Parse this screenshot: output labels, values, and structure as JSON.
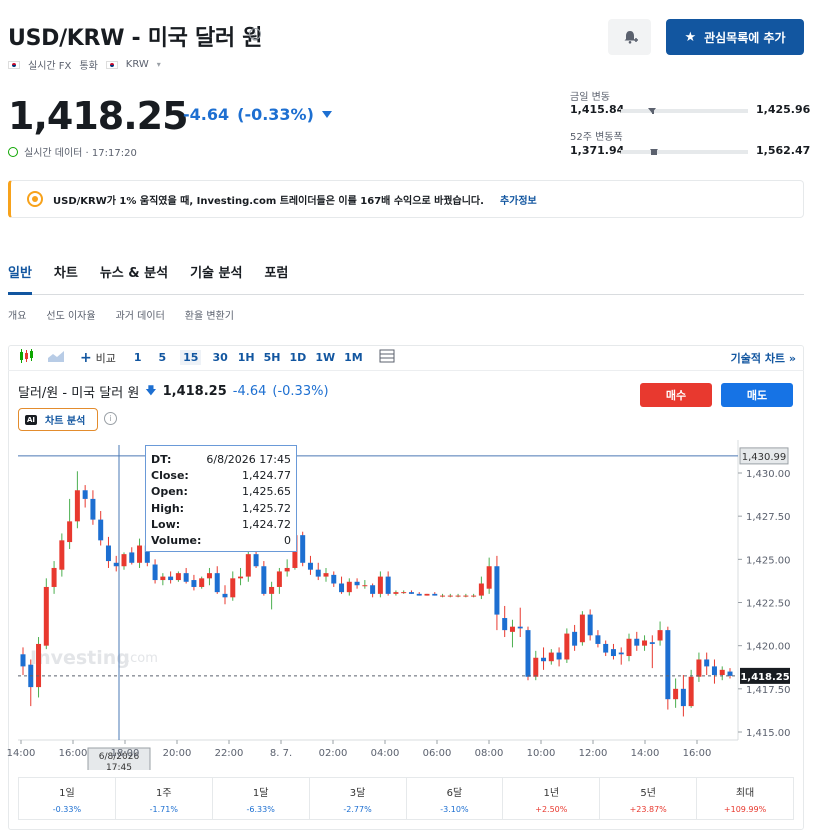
{
  "header": {
    "title": "USD/KRW - 미국 달러 원",
    "realtime_fx": "실시간 FX",
    "currency_label": "통화",
    "currency": "KRW",
    "watchlist_button": "관심목록에 추가"
  },
  "quote": {
    "price": "1,418.25",
    "change": "-4.64",
    "change_pct": "(-0.33%)",
    "realtime_label": "실시간 데이터 · 17:17:20"
  },
  "ranges": {
    "day_label": "금일 변동",
    "day_low": "1,415.84",
    "day_high": "1,425.96",
    "week52_label": "52주 변동폭",
    "week52_low": "1,371.94",
    "week52_high": "1,562.47"
  },
  "banner": {
    "text": "USD/KRW가 1% 움직였을 때, Investing.com 트레이더들은 이를 167배 수익으로 바꿨습니다.",
    "link": "추가정보"
  },
  "tabs": [
    "일반",
    "차트",
    "뉴스 & 분석",
    "기술 분석",
    "포럼"
  ],
  "subtabs": [
    "개요",
    "선도 이자율",
    "과거 데이터",
    "환율 변환기"
  ],
  "toolbar": {
    "compare": "비교",
    "intervals": [
      "1",
      "5",
      "15",
      "30",
      "1H",
      "5H",
      "1D",
      "1W",
      "1M"
    ],
    "active_interval": "15",
    "technical_chart": "기술적 차트 »"
  },
  "chart_header": {
    "name": "달러/원 - 미국 달러 원",
    "price": "1,418.25",
    "change": "-4.64",
    "change_pct": "(-0.33%)",
    "ai_label": "차트 분석",
    "ai_badge": "AI",
    "buy": "매수",
    "sell": "매도"
  },
  "tooltip": {
    "rows": [
      {
        "k": "DT:",
        "v": "6/8/2026 17:45"
      },
      {
        "k": "Close:",
        "v": "1,424.77"
      },
      {
        "k": "Open:",
        "v": "1,425.65"
      },
      {
        "k": "High:",
        "v": "1,425.72"
      },
      {
        "k": "Low:",
        "v": "1,424.72"
      },
      {
        "k": "Volume:",
        "v": "0"
      }
    ],
    "crosshair_date": "6/8/2026",
    "crosshair_time": "17:45",
    "crosshair_price": "1,430.99"
  },
  "watermark": "Investing.com",
  "chart_data": {
    "type": "candlestick",
    "interval": "15",
    "ylim": [
      1415.0,
      1431.5
    ],
    "y_ticks": [
      "1,430.00",
      "1,427.50",
      "1,425.00",
      "1,422.50",
      "1,420.00",
      "1,417.50",
      "1,415.00"
    ],
    "y_tick_values": [
      1430.0,
      1427.5,
      1425.0,
      1422.5,
      1420.0,
      1417.5,
      1415.0
    ],
    "x_ticks": [
      "14:00",
      "16:00",
      "18:00",
      "20:00",
      "22:00",
      "8. 7.",
      "02:00",
      "04:00",
      "06:00",
      "08:00",
      "10:00",
      "12:00",
      "14:00",
      "16:00"
    ],
    "last_price": 1418.25,
    "last_price_label": "1,418.25",
    "crosshair_price": 1430.99,
    "up_color": "#e8392f",
    "down_color": "#1d6fd1",
    "candles": [
      {
        "o": 1419.5,
        "h": 1419.9,
        "l": 1418.3,
        "c": 1418.8
      },
      {
        "o": 1418.9,
        "h": 1419.2,
        "l": 1416.5,
        "c": 1417.6
      },
      {
        "o": 1417.6,
        "h": 1420.5,
        "l": 1417.0,
        "c": 1420.1
      },
      {
        "o": 1420.0,
        "h": 1423.9,
        "l": 1419.8,
        "c": 1423.4
      },
      {
        "o": 1423.4,
        "h": 1424.9,
        "l": 1423.0,
        "c": 1424.5
      },
      {
        "o": 1424.4,
        "h": 1426.5,
        "l": 1424.0,
        "c": 1426.1
      },
      {
        "o": 1426.0,
        "h": 1428.5,
        "l": 1425.6,
        "c": 1427.2
      },
      {
        "o": 1427.2,
        "h": 1430.1,
        "l": 1426.8,
        "c": 1429.0
      },
      {
        "o": 1429.0,
        "h": 1429.3,
        "l": 1428.0,
        "c": 1428.5
      },
      {
        "o": 1428.5,
        "h": 1429.0,
        "l": 1427.0,
        "c": 1427.3
      },
      {
        "o": 1427.3,
        "h": 1427.8,
        "l": 1425.8,
        "c": 1426.1
      },
      {
        "o": 1425.8,
        "h": 1426.3,
        "l": 1424.5,
        "c": 1424.9
      },
      {
        "o": 1424.8,
        "h": 1425.2,
        "l": 1424.3,
        "c": 1424.6
      },
      {
        "o": 1424.6,
        "h": 1425.4,
        "l": 1424.4,
        "c": 1425.3
      },
      {
        "o": 1425.4,
        "h": 1425.7,
        "l": 1424.7,
        "c": 1424.8
      },
      {
        "o": 1424.8,
        "h": 1426.2,
        "l": 1424.5,
        "c": 1425.8
      },
      {
        "o": 1425.8,
        "h": 1426.3,
        "l": 1424.6,
        "c": 1424.8
      },
      {
        "o": 1424.7,
        "h": 1425.0,
        "l": 1423.6,
        "c": 1423.8
      },
      {
        "o": 1423.8,
        "h": 1424.2,
        "l": 1423.5,
        "c": 1424.0
      },
      {
        "o": 1424.0,
        "h": 1424.3,
        "l": 1423.6,
        "c": 1423.8
      },
      {
        "o": 1423.8,
        "h": 1424.3,
        "l": 1423.7,
        "c": 1424.2
      },
      {
        "o": 1424.2,
        "h": 1424.5,
        "l": 1423.6,
        "c": 1423.7
      },
      {
        "o": 1423.8,
        "h": 1424.1,
        "l": 1423.2,
        "c": 1423.4
      },
      {
        "o": 1423.4,
        "h": 1424.0,
        "l": 1423.3,
        "c": 1423.9
      },
      {
        "o": 1423.9,
        "h": 1424.5,
        "l": 1423.5,
        "c": 1424.2
      },
      {
        "o": 1424.2,
        "h": 1424.6,
        "l": 1423.0,
        "c": 1423.1
      },
      {
        "o": 1423.0,
        "h": 1423.5,
        "l": 1422.4,
        "c": 1422.8
      },
      {
        "o": 1422.8,
        "h": 1424.3,
        "l": 1422.6,
        "c": 1423.9
      },
      {
        "o": 1423.9,
        "h": 1424.5,
        "l": 1423.5,
        "c": 1424.0
      },
      {
        "o": 1424.0,
        "h": 1425.8,
        "l": 1423.7,
        "c": 1425.3
      },
      {
        "o": 1425.3,
        "h": 1425.7,
        "l": 1424.5,
        "c": 1424.6
      },
      {
        "o": 1424.6,
        "h": 1424.9,
        "l": 1422.9,
        "c": 1423.0
      },
      {
        "o": 1423.0,
        "h": 1423.7,
        "l": 1422.1,
        "c": 1423.4
      },
      {
        "o": 1423.4,
        "h": 1424.5,
        "l": 1423.0,
        "c": 1424.3
      },
      {
        "o": 1424.3,
        "h": 1425.0,
        "l": 1424.0,
        "c": 1424.5
      },
      {
        "o": 1424.5,
        "h": 1426.7,
        "l": 1424.4,
        "c": 1426.4
      },
      {
        "o": 1426.4,
        "h": 1426.6,
        "l": 1424.6,
        "c": 1424.8
      },
      {
        "o": 1424.8,
        "h": 1425.2,
        "l": 1424.1,
        "c": 1424.4
      },
      {
        "o": 1424.4,
        "h": 1424.8,
        "l": 1423.8,
        "c": 1424.0
      },
      {
        "o": 1424.0,
        "h": 1424.5,
        "l": 1423.7,
        "c": 1424.2
      },
      {
        "o": 1424.1,
        "h": 1424.3,
        "l": 1423.4,
        "c": 1423.6
      },
      {
        "o": 1423.6,
        "h": 1424.0,
        "l": 1423.0,
        "c": 1423.1
      },
      {
        "o": 1423.1,
        "h": 1423.9,
        "l": 1422.9,
        "c": 1423.7
      },
      {
        "o": 1423.7,
        "h": 1423.9,
        "l": 1423.3,
        "c": 1423.5
      },
      {
        "o": 1423.5,
        "h": 1423.8,
        "l": 1423.3,
        "c": 1423.5
      },
      {
        "o": 1423.5,
        "h": 1423.6,
        "l": 1422.8,
        "c": 1423.0
      },
      {
        "o": 1423.0,
        "h": 1424.3,
        "l": 1422.8,
        "c": 1424.0
      },
      {
        "o": 1424.0,
        "h": 1424.3,
        "l": 1422.9,
        "c": 1423.0
      },
      {
        "o": 1423.0,
        "h": 1423.2,
        "l": 1422.9,
        "c": 1423.1
      },
      {
        "o": 1423.1,
        "h": 1423.2,
        "l": 1423.0,
        "c": 1423.1
      },
      {
        "o": 1423.1,
        "h": 1423.2,
        "l": 1423.0,
        "c": 1423.0
      },
      {
        "o": 1423.0,
        "h": 1423.1,
        "l": 1422.9,
        "c": 1422.9
      },
      {
        "o": 1422.9,
        "h": 1423.0,
        "l": 1422.9,
        "c": 1423.0
      },
      {
        "o": 1423.0,
        "h": 1423.1,
        "l": 1422.9,
        "c": 1422.9
      },
      {
        "o": 1422.9,
        "h": 1423.0,
        "l": 1422.8,
        "c": 1422.9
      },
      {
        "o": 1422.9,
        "h": 1423.0,
        "l": 1422.8,
        "c": 1422.9
      },
      {
        "o": 1422.9,
        "h": 1423.0,
        "l": 1422.8,
        "c": 1422.9
      },
      {
        "o": 1422.9,
        "h": 1423.0,
        "l": 1422.8,
        "c": 1422.9
      },
      {
        "o": 1422.9,
        "h": 1423.0,
        "l": 1422.8,
        "c": 1422.9
      },
      {
        "o": 1422.9,
        "h": 1424.0,
        "l": 1422.7,
        "c": 1423.6
      },
      {
        "o": 1423.3,
        "h": 1425.1,
        "l": 1423.0,
        "c": 1424.6
      },
      {
        "o": 1424.6,
        "h": 1425.2,
        "l": 1420.9,
        "c": 1421.8
      },
      {
        "o": 1421.6,
        "h": 1422.3,
        "l": 1420.5,
        "c": 1420.9
      },
      {
        "o": 1420.8,
        "h": 1421.5,
        "l": 1419.9,
        "c": 1421.1
      },
      {
        "o": 1421.1,
        "h": 1422.2,
        "l": 1420.5,
        "c": 1421.0
      },
      {
        "o": 1420.9,
        "h": 1421.1,
        "l": 1418.0,
        "c": 1418.2
      },
      {
        "o": 1418.2,
        "h": 1419.7,
        "l": 1418.0,
        "c": 1419.3
      },
      {
        "o": 1419.3,
        "h": 1419.9,
        "l": 1418.6,
        "c": 1419.1
      },
      {
        "o": 1419.1,
        "h": 1419.8,
        "l": 1418.9,
        "c": 1419.6
      },
      {
        "o": 1419.6,
        "h": 1419.9,
        "l": 1418.8,
        "c": 1419.2
      },
      {
        "o": 1419.2,
        "h": 1421.0,
        "l": 1419.0,
        "c": 1420.7
      },
      {
        "o": 1420.8,
        "h": 1421.2,
        "l": 1419.7,
        "c": 1420.0
      },
      {
        "o": 1420.2,
        "h": 1422.0,
        "l": 1420.0,
        "c": 1421.8
      },
      {
        "o": 1421.8,
        "h": 1422.1,
        "l": 1420.3,
        "c": 1420.6
      },
      {
        "o": 1420.6,
        "h": 1420.9,
        "l": 1419.9,
        "c": 1420.1
      },
      {
        "o": 1420.1,
        "h": 1420.3,
        "l": 1419.4,
        "c": 1419.6
      },
      {
        "o": 1419.8,
        "h": 1420.1,
        "l": 1419.2,
        "c": 1419.4
      },
      {
        "o": 1419.6,
        "h": 1419.9,
        "l": 1418.9,
        "c": 1419.5
      },
      {
        "o": 1419.4,
        "h": 1420.7,
        "l": 1419.1,
        "c": 1420.4
      },
      {
        "o": 1420.4,
        "h": 1420.8,
        "l": 1419.7,
        "c": 1420.0
      },
      {
        "o": 1420.0,
        "h": 1420.6,
        "l": 1419.7,
        "c": 1420.3
      },
      {
        "o": 1420.2,
        "h": 1420.6,
        "l": 1418.7,
        "c": 1420.1
      },
      {
        "o": 1420.3,
        "h": 1421.4,
        "l": 1420.0,
        "c": 1420.9
      },
      {
        "o": 1420.9,
        "h": 1421.1,
        "l": 1416.3,
        "c": 1416.9
      },
      {
        "o": 1416.9,
        "h": 1418.1,
        "l": 1416.4,
        "c": 1417.5
      },
      {
        "o": 1417.5,
        "h": 1418.3,
        "l": 1415.9,
        "c": 1416.5
      },
      {
        "o": 1416.5,
        "h": 1418.6,
        "l": 1416.4,
        "c": 1418.2
      },
      {
        "o": 1418.2,
        "h": 1419.6,
        "l": 1417.9,
        "c": 1419.2
      },
      {
        "o": 1419.2,
        "h": 1419.6,
        "l": 1418.3,
        "c": 1418.8
      },
      {
        "o": 1418.8,
        "h": 1419.2,
        "l": 1417.8,
        "c": 1418.3
      },
      {
        "o": 1418.3,
        "h": 1418.8,
        "l": 1418.0,
        "c": 1418.6
      },
      {
        "o": 1418.5,
        "h": 1418.7,
        "l": 1418.1,
        "c": 1418.25
      }
    ]
  },
  "performance": [
    {
      "label": "1일",
      "value": "-0.33%",
      "dir": "neg"
    },
    {
      "label": "1주",
      "value": "-1.71%",
      "dir": "neg"
    },
    {
      "label": "1달",
      "value": "-6.33%",
      "dir": "neg"
    },
    {
      "label": "3달",
      "value": "-2.77%",
      "dir": "neg"
    },
    {
      "label": "6달",
      "value": "-3.10%",
      "dir": "neg"
    },
    {
      "label": "1년",
      "value": "+2.50%",
      "dir": "pos"
    },
    {
      "label": "5년",
      "value": "+23.87%",
      "dir": "pos"
    },
    {
      "label": "최대",
      "value": "+109.99%",
      "dir": "pos"
    }
  ]
}
